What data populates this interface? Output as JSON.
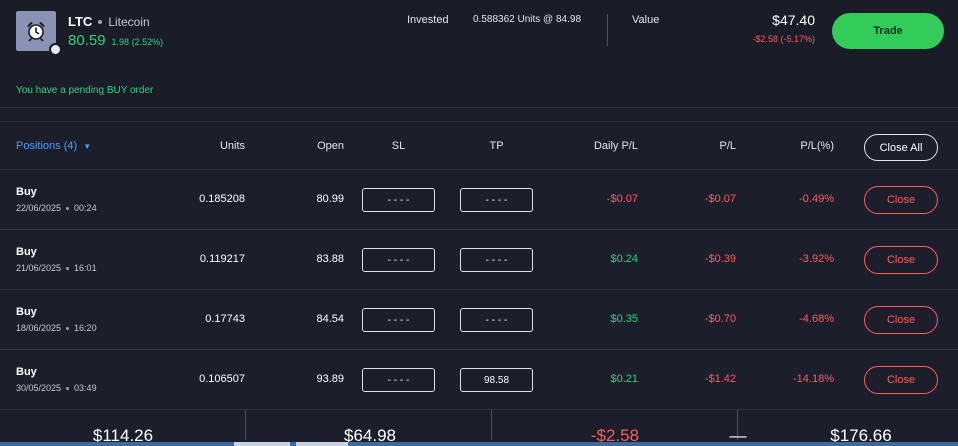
{
  "header": {
    "symbol": "LTC",
    "name": "Litecoin",
    "price": "80.59",
    "change": "1.98 (2.52%)",
    "invested_label": "Invested",
    "invested_value": "0.588362 Units @ 84.98",
    "value_label": "Value",
    "value_amount": "$47.40",
    "value_change": "-$2.58 (-5.17%)",
    "trade_label": "Trade",
    "pending_notice": "You have a pending BUY order",
    "logo_icon": "alarm-clock-icon",
    "colors": {
      "positive": "#33d17a",
      "negative": "#ff5b5b",
      "accent": "#4a9cff",
      "trade": "#33cc5a"
    }
  },
  "table": {
    "headers": {
      "positions": "Positions (4)",
      "units": "Units",
      "open": "Open",
      "sl": "SL",
      "tp": "TP",
      "daily_pl": "Daily P/L",
      "pl": "P/L",
      "pl_pct": "P/L(%)",
      "close_all": "Close All"
    },
    "rows": [
      {
        "side": "Buy",
        "date": "22/06/2025",
        "time": "00:24",
        "units": "0.185208",
        "open": "80.99",
        "sl": "- - - -",
        "tp": "- - - -",
        "daily_pl": "-$0.07",
        "pl": "-$0.07",
        "pl_pct": "-0.49%",
        "close": "Close"
      },
      {
        "side": "Buy",
        "date": "21/06/2025",
        "time": "16:01",
        "units": "0.119217",
        "open": "83.88",
        "sl": "- - - -",
        "tp": "- - - -",
        "daily_pl": "$0.24",
        "pl": "-$0.39",
        "pl_pct": "-3.92%",
        "close": "Close"
      },
      {
        "side": "Buy",
        "date": "18/06/2025",
        "time": "16:20",
        "units": "0.17743",
        "open": "84.54",
        "sl": "- - - -",
        "tp": "- - - -",
        "daily_pl": "$0.35",
        "pl": "-$0.70",
        "pl_pct": "-4.68%",
        "close": "Close"
      },
      {
        "side": "Buy",
        "date": "30/05/2025",
        "time": "03:49",
        "units": "0.106507",
        "open": "93.89",
        "sl": "- - - -",
        "tp": "98.58",
        "daily_pl": "$0.21",
        "pl": "-$1.42",
        "pl_pct": "-14.18%",
        "close": "Close"
      }
    ]
  },
  "footer": {
    "totals": [
      "$114.26",
      "$64.98",
      "-$2.58",
      "—",
      "$176.66"
    ]
  }
}
